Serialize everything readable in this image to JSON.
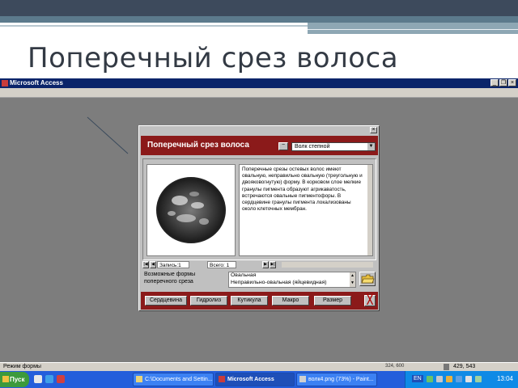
{
  "slide": {
    "title": "Поперечный срез волоса"
  },
  "app": {
    "title": "Microsoft Access",
    "window_buttons": {
      "minimize": "_",
      "restore": "❐",
      "close": "×"
    }
  },
  "form": {
    "heading": "Поперечный срез волоса",
    "species_value": "Волк степной",
    "description": "Поперечные срезы остевых волос имеют овальную, неправильно овальную (треугольную и двояковогнутую) форму. В корковом слое мелкие гранулы пигмента образуют агрикаватость, встречаются овальные пигментофоры. В сердцевине гранулы пигмента локализованы около клеточных мембран.",
    "nav": {
      "record_label": "Запись:",
      "record_value": "1",
      "total_label": "Всего:",
      "total_value": "1"
    },
    "forms_label": "Возможные формы поперечного среза",
    "forms_options": [
      "Овальная",
      "Неправильно-овальная (яйцевидная)"
    ],
    "buttons": [
      "Сердцевина",
      "Гидролиз",
      "Кутикула",
      "Макро",
      "Размер"
    ],
    "close_glyph": "╳"
  },
  "statusbar": {
    "text": "Режим формы",
    "coords": "324, 600",
    "size": "429, 543"
  },
  "taskbar": {
    "start_label": "Пуск",
    "tasks": [
      {
        "label": "C:\\Documents and Settin...",
        "active": false
      },
      {
        "label": "Microsoft Access",
        "active": true
      },
      {
        "label": "волк4.png (73%) - Paint...",
        "active": false
      }
    ],
    "language": "EN",
    "clock": "13:04"
  }
}
